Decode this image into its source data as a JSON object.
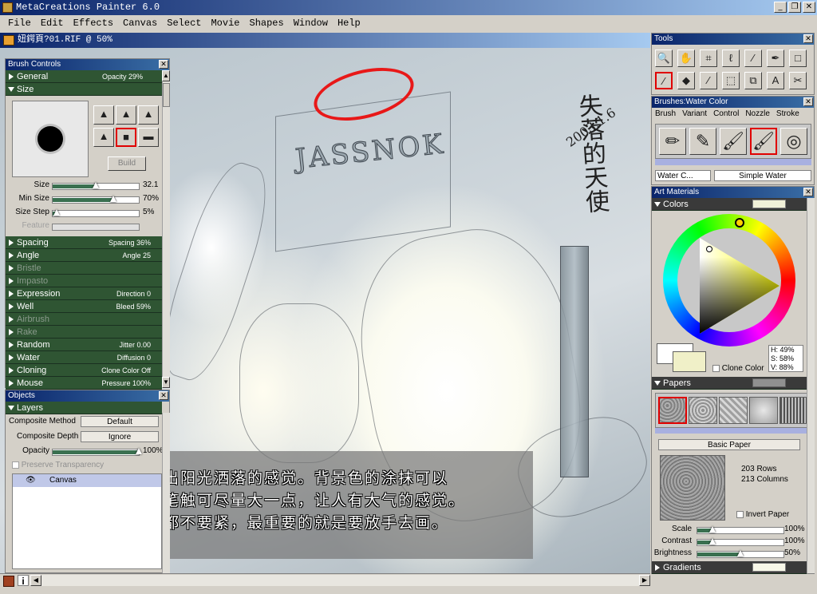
{
  "app": {
    "title": "MetaCreations Painter 6.0"
  },
  "menu": [
    "File",
    "Edit",
    "Effects",
    "Canvas",
    "Select",
    "Movie",
    "Shapes",
    "Window",
    "Help"
  ],
  "document": {
    "title": "妞鍔頁?01.RIF @ 50%",
    "signature": "失落的天使",
    "date": "2003.1.6",
    "sign_text": "JASSNOK",
    "caption": [
      "再利用淡黄色拉出阳光洒落的感觉。背景色的涂抹可以",
      "适当的放松些，笔触可尽量大一点，让人有大气的感觉。",
      "画出头或者画错都不要紧，最重要的就是要放手去画。"
    ]
  },
  "brush_controls": {
    "title": "Brush Controls",
    "general": {
      "label": "General",
      "value": "Opacity 29%"
    },
    "size": {
      "label": "Size"
    },
    "build_label": "Build",
    "size_sliders": [
      {
        "label": "Size",
        "value": "32.1",
        "fraction": 0.5
      },
      {
        "label": "Min Size",
        "value": "70%",
        "fraction": 0.7
      },
      {
        "label": "Size Step",
        "value": "5%",
        "fraction": 0.05
      }
    ],
    "feature_label": "Feature",
    "sections": [
      {
        "label": "Spacing",
        "value": "Spacing 36%"
      },
      {
        "label": "Angle",
        "value": "Angle 25"
      },
      {
        "label": "Bristle",
        "value": ""
      },
      {
        "label": "Impasto",
        "value": ""
      },
      {
        "label": "Expression",
        "value": "Direction 0"
      },
      {
        "label": "Well",
        "value": "Bleed 59%"
      },
      {
        "label": "Airbrush",
        "value": ""
      },
      {
        "label": "Rake",
        "value": ""
      },
      {
        "label": "Random",
        "value": "Jitter 0.00"
      },
      {
        "label": "Water",
        "value": "Diffusion 0"
      },
      {
        "label": "Cloning",
        "value": "Clone Color Off"
      },
      {
        "label": "Mouse",
        "value": "Pressure 100%"
      }
    ]
  },
  "objects": {
    "title": "Objects",
    "layers_label": "Layers",
    "composite_method_label": "Composite Method",
    "composite_method": "Default",
    "composite_depth_label": "Composite Depth",
    "composite_depth": "Ignore",
    "opacity_label": "Opacity",
    "opacity_value": "100%",
    "opacity_fraction": 1.0,
    "preserve_label": "Preserve Transparency",
    "layer_name": "Canvas"
  },
  "tools": {
    "title": "Tools"
  },
  "brushes": {
    "title": "Brushes:Water Color",
    "tabs": [
      "Brush",
      "Variant",
      "Control",
      "Nozzle",
      "Stroke"
    ],
    "brush_name": "Water C...",
    "variant_name": "Simple Water"
  },
  "art_materials": {
    "title": "Art Materials",
    "colors_label": "Colors",
    "clone_color_label": "Clone Color",
    "hsv": {
      "h": "H: 49%",
      "s": "S: 58%",
      "v": "V: 88%"
    },
    "papers_label": "Papers",
    "paper_name": "Basic Paper",
    "rows": "203 Rows",
    "columns": "213 Columns",
    "invert_label": "Invert Paper",
    "paper_sliders": [
      {
        "label": "Scale",
        "value": "100%",
        "fraction": 0.18
      },
      {
        "label": "Contrast",
        "value": "100%",
        "fraction": 0.18
      },
      {
        "label": "Brightness",
        "value": "50%",
        "fraction": 0.5
      }
    ],
    "gradients_label": "Gradients"
  }
}
